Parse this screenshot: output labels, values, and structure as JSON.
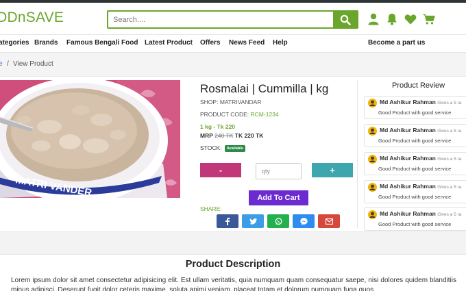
{
  "header": {
    "logo": "ODnSAVE",
    "search_placeholder": "Search....",
    "icons": [
      "user-icon",
      "bell-icon",
      "heart-icon",
      "cart-icon"
    ]
  },
  "nav": {
    "items": [
      "ategories",
      "Brands",
      "Famous Bengali Food",
      "Latest Product",
      "Offers",
      "News Feed",
      "Help"
    ],
    "right": "Become a part us"
  },
  "breadcrumb": {
    "home": "e",
    "sep": "/",
    "current": "View Product"
  },
  "product": {
    "title": "Rosmalai | Cummilla | kg",
    "shop_label": "SHOP:",
    "shop": "MATRIVANDAR",
    "code_label": "PRODUCT CODE:",
    "code": "RCM-1234",
    "variant_price": "1 kg - Tk 220",
    "mrp_label": "MRP",
    "mrp_old": "240 TK",
    "mrp_new": "TK 220 TK",
    "stock_label": "STOCK:",
    "stock_badge": "Available",
    "image_text": "MATRI VANDER"
  },
  "actions": {
    "minus": "-",
    "qty_placeholder": "qty",
    "plus": "+",
    "add_to_cart": "Add To Cart",
    "share_label": "SHARE:",
    "share_icons": [
      "facebook-icon",
      "twitter-icon",
      "whatsapp-icon",
      "messenger-icon",
      "gmail-icon"
    ]
  },
  "reviews": {
    "heading": "Product Review",
    "items": [
      {
        "name": "Md Ashikur Rahman",
        "note": "Gives a 5 ra",
        "text": "Good Product with good service"
      },
      {
        "name": "Md Ashikur Rahman",
        "note": "Gives a 5 ra",
        "text": "Good Product with good service"
      },
      {
        "name": "Md Ashikur Rahman",
        "note": "Gives a 5 ra",
        "text": "Good Product with good service"
      },
      {
        "name": "Md Ashikur Rahman",
        "note": "Gives a 5 ra",
        "text": "Good Product with good service"
      },
      {
        "name": "Md Ashikur Rahman",
        "note": "Gives a 5 ra",
        "text": "Good Product with good service"
      }
    ]
  },
  "description": {
    "title": "Product Description",
    "body": "Lorem ipsum dolor sit amet consectetur adipisicing elit. Est ullam veritatis, quia numquam quam consequatur saepe, nisi dolores quidem blanditiis minus adipisci. Deserunt fugit dolor ceteris maxime, soluta animi veniam, placeat totam et dolorum numquam fuga quos."
  },
  "colors": {
    "brand": "#6aa62b",
    "minus": "#c0387a",
    "plus": "#3ea6ad",
    "cart": "#6b2bd1"
  }
}
